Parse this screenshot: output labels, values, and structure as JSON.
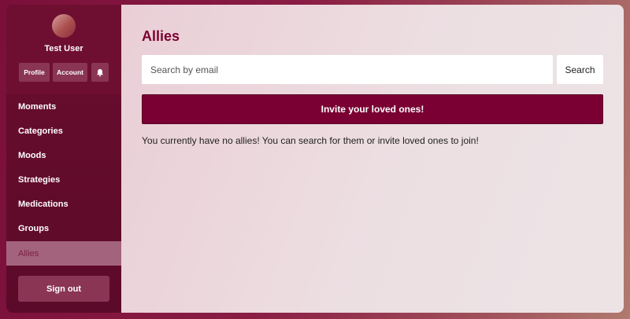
{
  "sidebar": {
    "user_name": "Test User",
    "buttons": {
      "profile": "Profile",
      "account": "Account",
      "notifications_icon": "bell-icon"
    },
    "nav": [
      {
        "label": "Moments"
      },
      {
        "label": "Categories"
      },
      {
        "label": "Moods"
      },
      {
        "label": "Strategies"
      },
      {
        "label": "Medications"
      },
      {
        "label": "Groups"
      },
      {
        "label": "Allies",
        "active": true
      }
    ],
    "sign_out": "Sign out"
  },
  "main": {
    "title": "Allies",
    "search": {
      "placeholder": "Search by email",
      "button": "Search"
    },
    "invite_button": "Invite your loved ones!",
    "empty_message": "You currently have no allies! You can search for them or invite loved ones to join!"
  },
  "colors": {
    "brand": "#7a0033",
    "sidebar": "#5c0a29",
    "active_nav": "#a4637c"
  }
}
